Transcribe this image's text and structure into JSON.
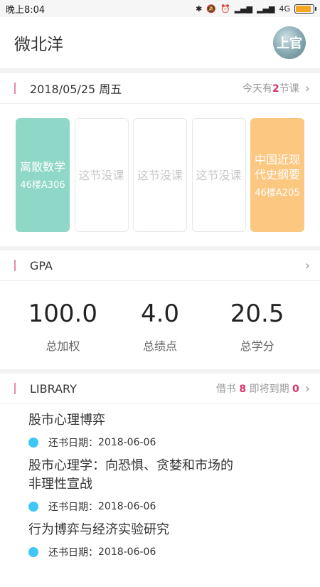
{
  "status": {
    "time": "晚上8:04",
    "network": "4G",
    "battery_level": 0.9,
    "icons": [
      "bluetooth-icon",
      "mute-icon",
      "alarm-icon",
      "signal-icon",
      "signal-icon"
    ]
  },
  "app": {
    "title": "微北洋",
    "avatar_text": "上官"
  },
  "schedule": {
    "date": "2018/05/25 周五",
    "summary_prefix": "今天有",
    "count": "2",
    "summary_suffix": "节课",
    "courses": [
      {
        "name": "离散数学",
        "room": "46楼A306",
        "color": "#8fd7c6"
      },
      {
        "name": "这节没课",
        "room": ""
      },
      {
        "name": "这节没课",
        "room": ""
      },
      {
        "name": "这节没课",
        "room": ""
      },
      {
        "name": "中国近现代史纲要",
        "room": "46楼A205",
        "color": "#fbc781"
      }
    ]
  },
  "gpa": {
    "title": "GPA",
    "items": [
      {
        "value": "100.0",
        "label": "总加权"
      },
      {
        "value": "4.0",
        "label": "总绩点"
      },
      {
        "value": "20.5",
        "label": "总学分"
      }
    ]
  },
  "library": {
    "title": "LIBRARY",
    "borrow_label": "借书",
    "borrow_count": "8",
    "due_label": "即将到期",
    "due_count": "0",
    "books": [
      {
        "title": "股市心理博弈",
        "due_label": "还书日期：",
        "due_date": "2018-06-06"
      },
      {
        "title": "股市心理学：向恐惧、贪婪和市场的非理性宣战",
        "due_label": "还书日期：",
        "due_date": "2018-06-06"
      },
      {
        "title": "行为博弈与经济实验研究",
        "due_label": "还书日期：",
        "due_date": "2018-06-06"
      }
    ]
  },
  "colors": {
    "accent": "#d6336c",
    "dot": "#3ec6f5"
  }
}
